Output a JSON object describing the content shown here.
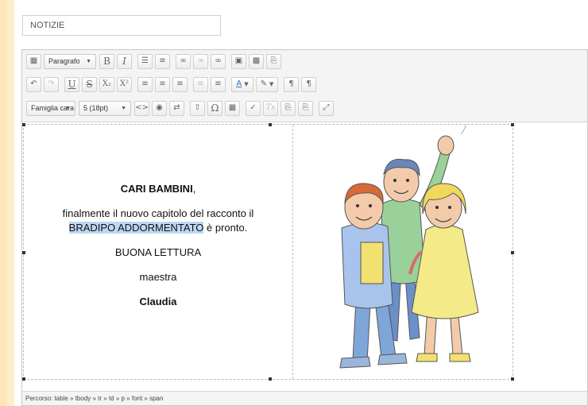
{
  "title_field": {
    "value": "NOTIZIE"
  },
  "toolbar": {
    "format_select": "Paragrafo",
    "font_family_select": "Famiglia cara",
    "font_size_select": "5 (18pt)",
    "bold": "B",
    "italic": "I",
    "underline": "U",
    "strikethrough": "S",
    "subscript": "X₂",
    "superscript": "X²",
    "text_color": "A",
    "omega": "Ω",
    "clear_format": "Tx",
    "paragraph_ltr": "¶",
    "paragraph_rtl": "¶"
  },
  "document": {
    "line1": "CARI BAMBINI",
    "line1_suffix": ",",
    "line2": "finalmente il nuovo capitolo del racconto il",
    "line3_selected": "BRADIPO ADDORMENTATO",
    "line3_rest": " è pronto.",
    "line4": "BUONA LETTURA",
    "line5": "maestra",
    "line6": "Claudia"
  },
  "statusbar": {
    "path": "Percorso: table » tbody » tr » td » p » font » span"
  },
  "colors": {
    "background": "#fbe7b9",
    "selection": "#bcd7f3"
  }
}
